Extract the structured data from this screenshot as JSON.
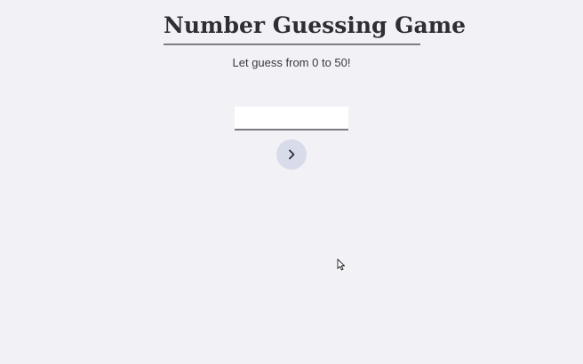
{
  "header": {
    "title": "Number Guessing Game",
    "subtitle": "Let guess from 0 to 50!"
  },
  "form": {
    "guess_value": "",
    "guess_placeholder": "",
    "submit_icon": "chevron-right-icon"
  },
  "colors": {
    "background": "#f1f1f6",
    "button_background": "#d8dbea",
    "underline": "#7d7d85"
  }
}
